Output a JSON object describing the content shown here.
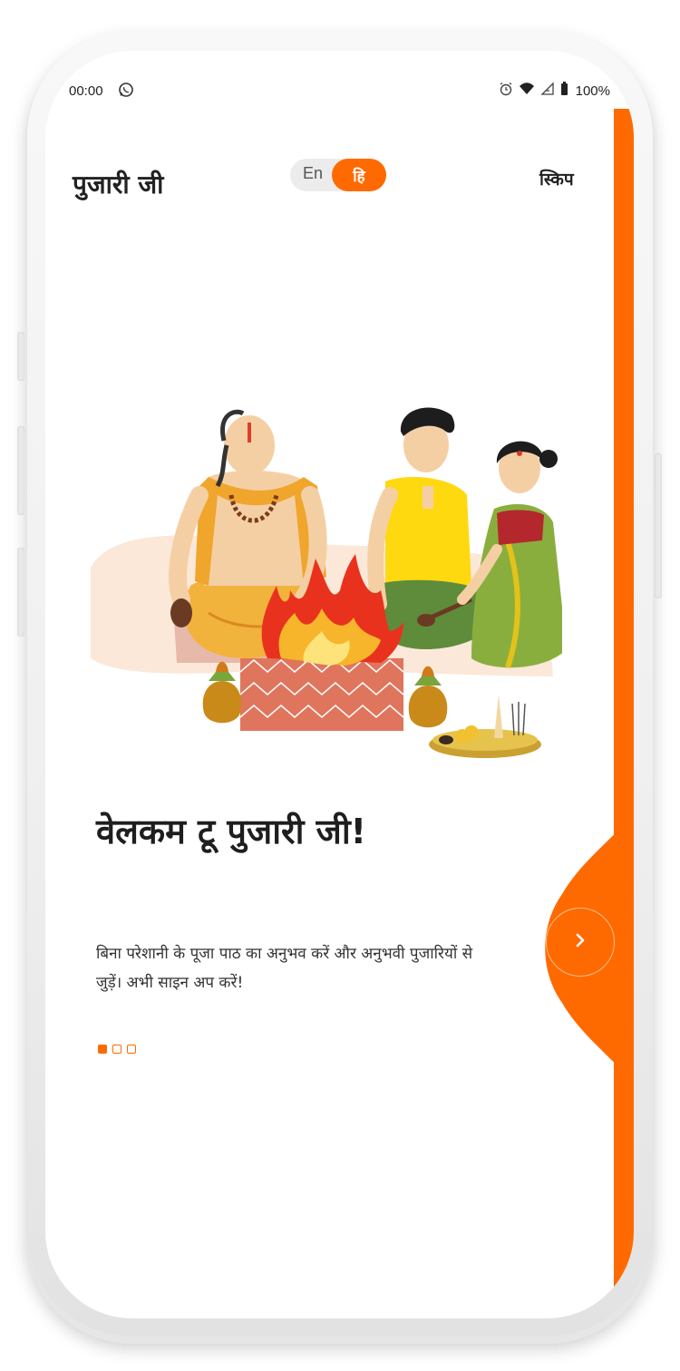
{
  "status_bar": {
    "time": "00:00",
    "battery": "100%"
  },
  "header": {
    "app_title": "पुजारी जी",
    "lang_en": "En",
    "lang_hi": "हि",
    "skip_label": "स्किप"
  },
  "onboarding": {
    "title": "वेलकम टू पुजारी जी!",
    "description": "बिना परेशानी के पूजा पाठ का अनुभव करें और अनुभवी पुजारियों से जुड़ें। अभी साइन अप करें!",
    "page_count": 3,
    "active_page": 1
  },
  "colors": {
    "accent": "#ff6a00",
    "text_primary": "#1e1e1e",
    "toggle_bg": "#ececec"
  },
  "icons": {
    "status_whatsapp": "whatsapp-icon",
    "status_alarm": "alarm-icon",
    "status_wifi": "wifi-icon",
    "status_signal": "signal-icon",
    "status_battery": "battery-icon",
    "next": "chevron-right-icon"
  }
}
